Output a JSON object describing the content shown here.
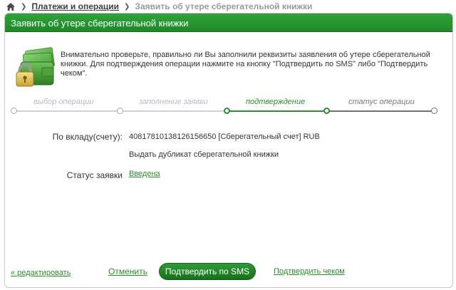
{
  "breadcrumb": {
    "section": "Платежи и операции",
    "current": "Заявить об утере сберегательной книжки"
  },
  "panel": {
    "title": "Заявить об утере сберегательной книжки"
  },
  "intro": {
    "text": "Внимательно проверьте, правильно ли Вы заполнили реквизиты заявления об утере сберегательной книжки. Для подтверждения операции нажмите на кнопку \"Подтвердить по SMS\" либо \"Подтвердить чеком\"."
  },
  "progress": {
    "steps": [
      {
        "label": "выбор операции",
        "state": "done"
      },
      {
        "label": "заполнение заявки",
        "state": "done"
      },
      {
        "label": "подтверждение",
        "state": "active"
      },
      {
        "label": "статус операции",
        "state": "next"
      }
    ]
  },
  "fields": {
    "account_label": "По вкладу(счету):",
    "account_value": "40817810138126156650  [Сберегательный счет]  RUB",
    "action_value": "Выдать дубликат сберегательной книжки",
    "status_label": "Статус заявки",
    "status_value": "Введена"
  },
  "footer": {
    "edit_label": "« редактировать",
    "cancel_label": "Отменить",
    "sms_button_label": "Подтвердить по SMS",
    "check_label": "Подтвердить чеком"
  },
  "colors": {
    "brand_green": "#2e8b2e",
    "header_green": "#1f8a28",
    "inactive_track": "#c8c8d8",
    "next_track": "#6a7280"
  }
}
